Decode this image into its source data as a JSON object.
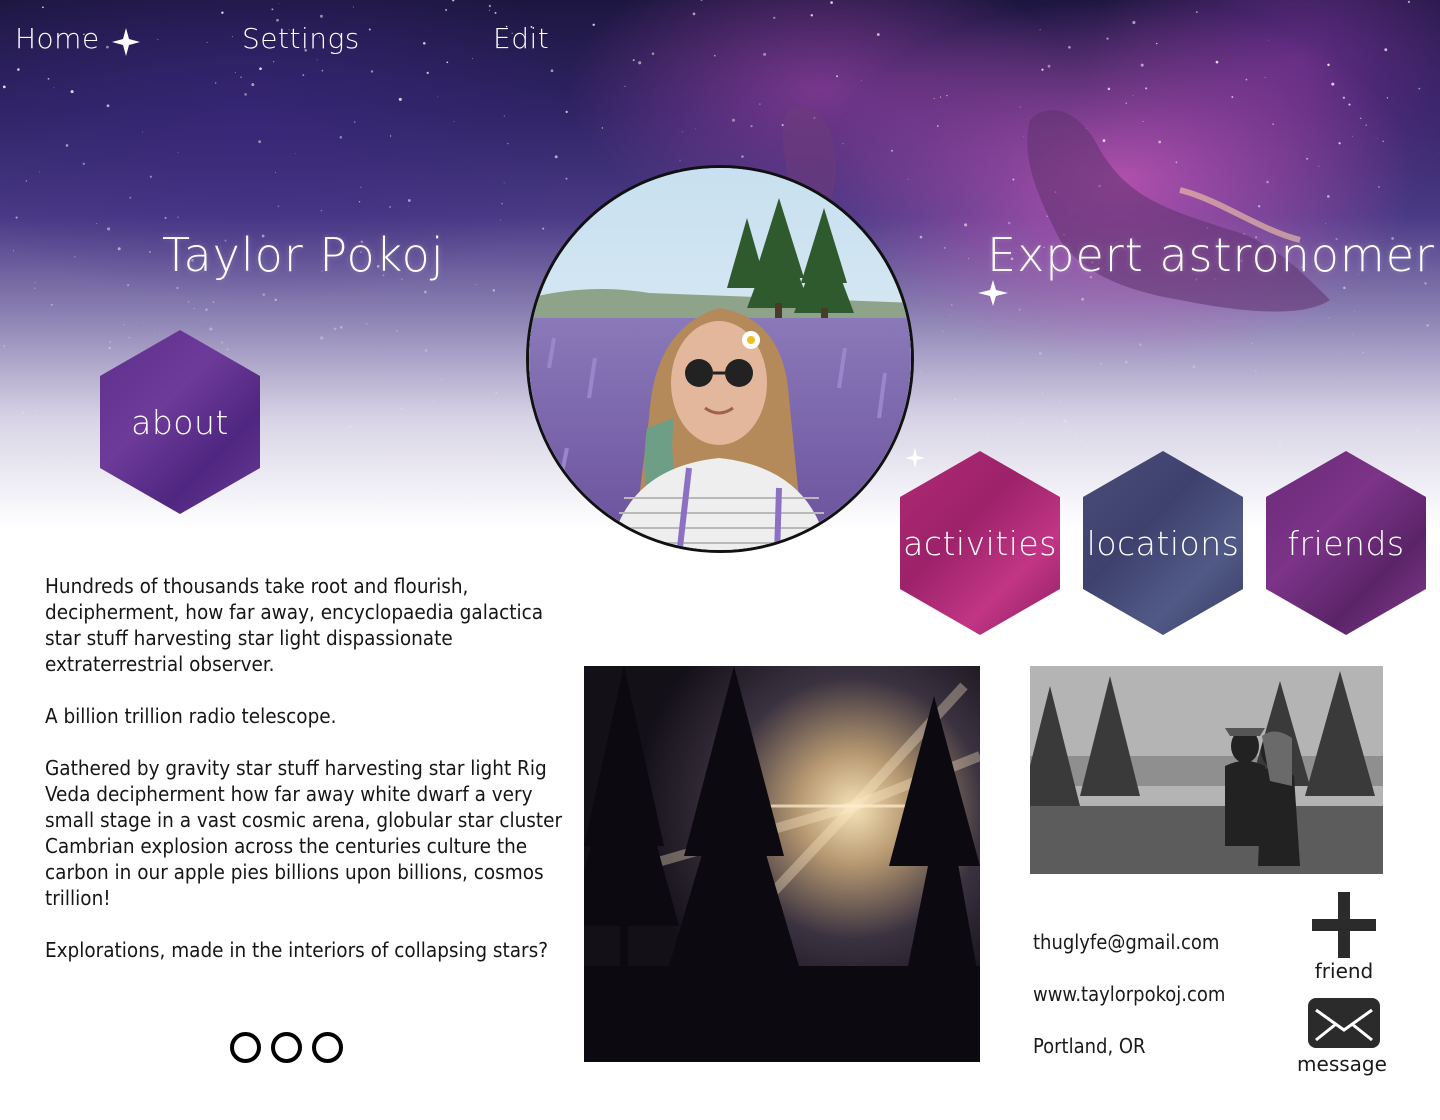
{
  "nav": {
    "home": "Home",
    "settings": "Settings",
    "edit": "Edit"
  },
  "profile": {
    "name": "Taylor Pokoj",
    "title": "Expert astronomer"
  },
  "sections": {
    "about": "about",
    "activities": "activities",
    "locations": "locations",
    "friends": "friends"
  },
  "bio": {
    "p1": "Hundreds of thousands take root and flourish, decipherment, how far away, encyclopaedia galactica star stuff harvesting star light dispassionate extraterrestrial observer.",
    "p2": "A billion trillion radio telescope.",
    "p3": "Gathered by gravity star stuff harvesting star light Rig Veda decipherment how far away white dwarf a very small stage in a vast cosmic arena, globular star cluster Cambrian explosion across the centuries culture the carbon in our apple pies billions upon billions, cosmos trillion!",
    "p4": "Explorations, made in the interiors of collapsing stars?"
  },
  "contact": {
    "email": "thuglyfe@gmail.com",
    "website": "www.taylorpokoj.com",
    "location": "Portland, OR"
  },
  "actions": {
    "friend_label": "friend",
    "message_label": "message"
  },
  "colors": {
    "about_hex": "#5e2f8c",
    "activities_hex": "#b02a74",
    "locations_hex": "#4b4d78",
    "friends_hex": "#6b2a78"
  },
  "icons": {
    "friend": "plus-icon",
    "message": "envelope-icon"
  }
}
